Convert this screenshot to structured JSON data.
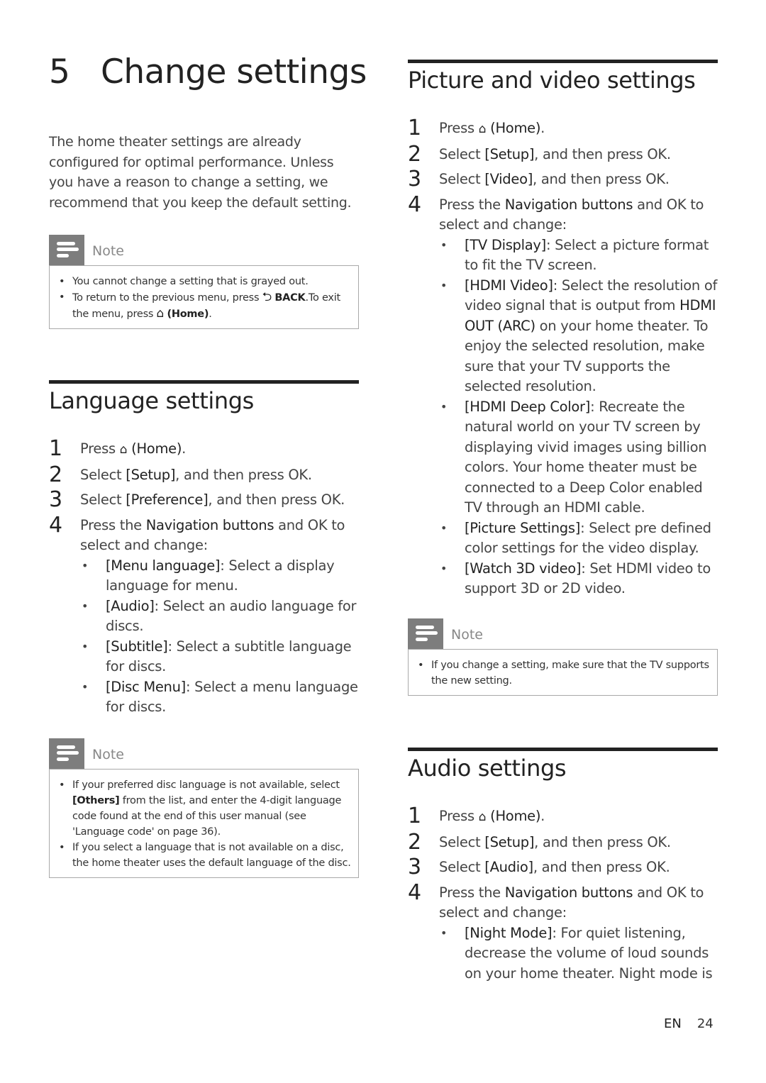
{
  "chapter": {
    "number": "5",
    "title": "Change settings"
  },
  "intro": "The home theater settings are already configured for optimal performance. Unless you have a reason to change a setting, we recommend that you keep the default setting.",
  "icons": {
    "note": "note-lines-icon",
    "home": "home-icon",
    "back": "back-arrow-icon"
  },
  "note_label": "Note",
  "note1": {
    "items": [
      {
        "text": "You cannot change a setting that is grayed out."
      },
      {
        "pre": "To return to the previous menu, press ",
        "back_glyph": "⮌",
        "back_label": "BACK",
        "mid": ".To exit the menu, press ",
        "home_glyph": "⌂",
        "home_label": "(Home)",
        "post": "."
      }
    ]
  },
  "language": {
    "title": "Language settings",
    "steps": [
      {
        "num": "1",
        "pre": "Press ",
        "home_glyph": "⌂",
        "bold": "(Home)",
        "post": "."
      },
      {
        "num": "2",
        "pre": "Select ",
        "bold": "[Setup]",
        "post": ", and then press OK."
      },
      {
        "num": "3",
        "pre": "Select ",
        "bold": "[Preference]",
        "post": ", and then press OK."
      },
      {
        "num": "4",
        "pre": "Press the ",
        "bold": "Navigation buttons",
        "post": " and OK to select and change:"
      }
    ],
    "options": [
      {
        "name": "[Menu language]",
        "desc": ": Select a display language for menu."
      },
      {
        "name": "[Audio]",
        "desc": ": Select an audio language for discs."
      },
      {
        "name": "[Subtitle]",
        "desc": ": Select a subtitle language for discs."
      },
      {
        "name": "[Disc Menu]",
        "desc": ": Select a menu language for discs."
      }
    ]
  },
  "note2": {
    "items": [
      {
        "pre": "If your preferred disc language is not available, select ",
        "bold": "[Others]",
        "post": " from the list, and enter the 4-digit language code found at the end of this user manual (see 'Language code' on page 36)."
      },
      {
        "text": "If you select a language that is not available on a disc, the home theater uses the default language of the disc."
      }
    ]
  },
  "video": {
    "title": "Picture and video settings",
    "steps": [
      {
        "num": "1",
        "pre": "Press ",
        "home_glyph": "⌂",
        "bold": "(Home)",
        "post": "."
      },
      {
        "num": "2",
        "pre": "Select ",
        "bold": "[Setup]",
        "post": ", and then press OK."
      },
      {
        "num": "3",
        "pre": "Select ",
        "bold": "[Video]",
        "post": ", and then press OK."
      },
      {
        "num": "4",
        "pre": "Press the ",
        "bold": "Navigation buttons",
        "post": " and OK to select and change:"
      }
    ],
    "options": [
      {
        "name": "[TV Display]",
        "desc": ": Select a picture format to fit the TV screen."
      },
      {
        "name": "[HDMI Video]",
        "desc": ": Select the resolution of video signal that is output from ",
        "bold2": "HDMI OUT (ARC)",
        "desc2": " on your home theater. To enjoy the selected resolution, make sure that your TV supports the selected resolution."
      },
      {
        "name": "[HDMI Deep Color]",
        "desc": ": Recreate the natural world on your TV screen by displaying vivid images using billion colors. Your home theater must be connected to a Deep Color enabled TV through an HDMI cable."
      },
      {
        "name": "[Picture Settings]",
        "desc": ": Select pre defined color settings for the video display."
      },
      {
        "name": "[Watch 3D video]",
        "desc": ": Set HDMI video to support 3D or 2D video."
      }
    ]
  },
  "note3": {
    "items": [
      {
        "text": "If you change a setting, make sure that the TV supports the new setting."
      }
    ]
  },
  "audio": {
    "title": "Audio settings",
    "steps": [
      {
        "num": "1",
        "pre": "Press ",
        "home_glyph": "⌂",
        "bold": "(Home)",
        "post": "."
      },
      {
        "num": "2",
        "pre": "Select ",
        "bold": "[Setup]",
        "post": ", and then press OK."
      },
      {
        "num": "3",
        "pre": "Select ",
        "bold": "[Audio]",
        "post": ", and then press OK."
      },
      {
        "num": "4",
        "pre": "Press the ",
        "bold": "Navigation buttons",
        "post": " and OK to select and change:"
      }
    ],
    "options": [
      {
        "name": "[Night Mode]",
        "desc": ": For quiet listening, decrease the volume of loud sounds on your home theater. Night mode is"
      }
    ]
  },
  "footer": {
    "lang": "EN",
    "page": "24"
  }
}
